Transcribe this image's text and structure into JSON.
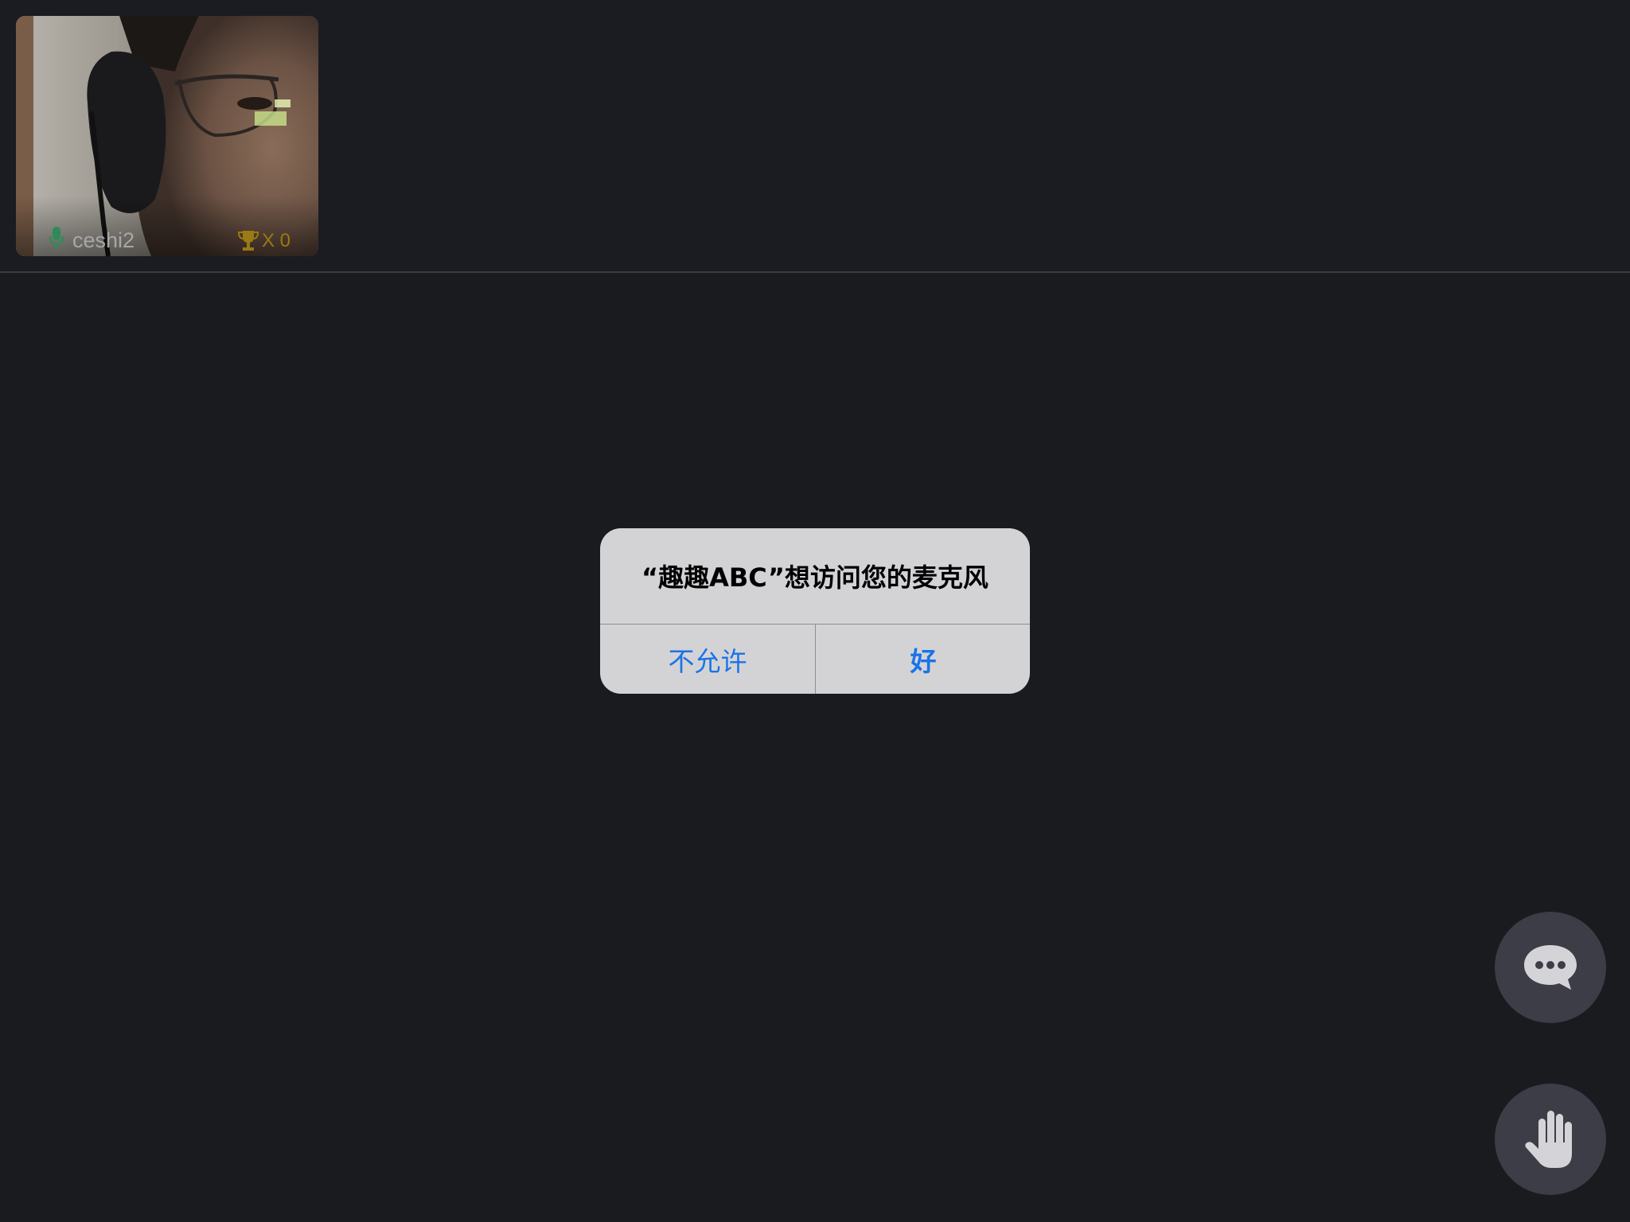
{
  "participant": {
    "name": "ceshi2",
    "trophy_count": "X 0",
    "mic_color": "#2e8b57",
    "trophy_color": "#9a7a12"
  },
  "alert": {
    "title": "“趣趣ABC”想访问您的麦克风",
    "deny_label": "不允许",
    "allow_label": "好",
    "button_color": "#1a73e8"
  },
  "actions": {
    "chat_icon": "chat-bubble-icon",
    "raise_hand_icon": "raise-hand-icon"
  }
}
